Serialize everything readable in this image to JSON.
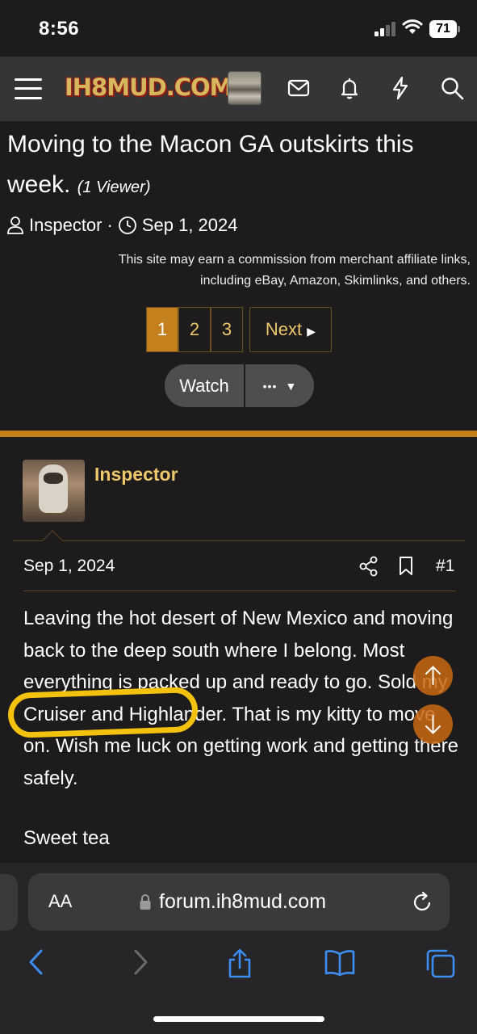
{
  "status_bar": {
    "time": "8:56",
    "battery": "71"
  },
  "header": {
    "logo": "IH8MUD.COM",
    "icons": [
      "menu-icon",
      "inbox-icon",
      "bell-icon",
      "bolt-icon",
      "search-icon"
    ]
  },
  "thread": {
    "title": "Moving to the Macon GA outskirts this week.",
    "viewers": "(1 Viewer)",
    "author": "Inspector",
    "separator": "·",
    "date": "Sep 1, 2024",
    "affiliate_note": "This site may earn a commission from merchant affiliate links, including eBay, Amazon, Skimlinks, and others."
  },
  "pagination": {
    "pages": [
      "1",
      "2",
      "3"
    ],
    "current": "1",
    "next_label": "Next"
  },
  "actions": {
    "watch_label": "Watch",
    "more_label": "•••"
  },
  "post": {
    "author": "Inspector",
    "date": "Sep 1, 2024",
    "number": "#1",
    "body": "Leaving the hot desert of New Mexico and moving back to the deep south where I belong. Most everything is packed up and ready to go. Sold my Cruiser and Highlander. That is my kitty to move on. Wish me luck on getting work and getting there safely.",
    "signoff": "Sweet tea"
  },
  "browser": {
    "text_size_label": "AA",
    "url": "forum.ih8mud.com"
  },
  "colors": {
    "accent": "#c4801c",
    "link": "#ecc86b",
    "highlight": "#f2c20e",
    "header_bg": "#353536",
    "page_bg": "#1e1b1c"
  }
}
